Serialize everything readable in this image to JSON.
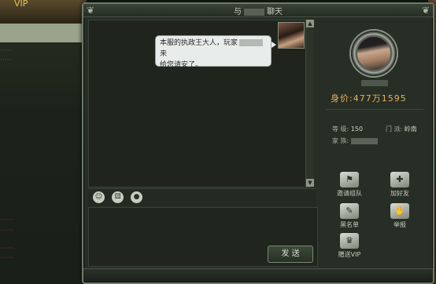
{
  "window": {
    "title_prefix": "与",
    "title_suffix": "聊天"
  },
  "bg": {
    "vip_label": "VIP"
  },
  "chat": {
    "message_part1": "本服的执政王大人，玩家",
    "message_part2": "来",
    "message_part3": "给您请安了。"
  },
  "toolbar": {
    "icons": [
      "smiley-icon",
      "dice-icon",
      "location-icon"
    ]
  },
  "input": {
    "send_label": "发 送"
  },
  "profile": {
    "worth_label": "身价:",
    "worth_value": "477万1595",
    "level_label": "等 级:",
    "level_value": "150",
    "faction_label": "门 派:",
    "faction_value": "岭南",
    "family_label": "家 族:"
  },
  "actions": {
    "invite_team": "邀请组队",
    "add_friend": "加好友",
    "blacklist": "黑名单",
    "report": "举报",
    "gift_vip": "赠送VIP"
  }
}
